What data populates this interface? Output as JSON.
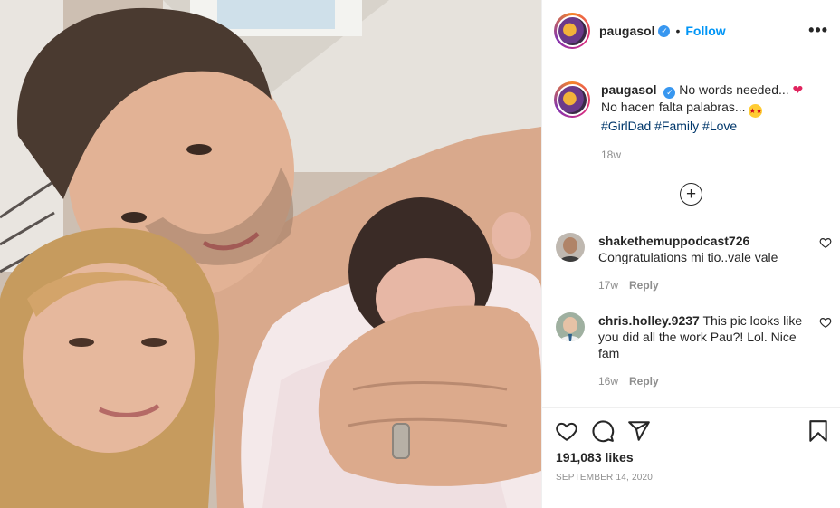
{
  "post": {
    "username": "paugasol",
    "follow_label": "Follow",
    "more_label": "•••",
    "caption_line1": "No words needed... ",
    "caption_line2": "No hacen falta palabras... ",
    "hashtags": [
      "#GirlDad",
      "#Family",
      "#Love"
    ],
    "caption_time": "18w",
    "likes": "191,083 likes",
    "date": "SEPTEMBER 14, 2020"
  },
  "comments": [
    {
      "username": "shakethemuppodcast726",
      "text": "Congratulations mi tio..vale vale",
      "time": "17w",
      "reply_label": "Reply"
    },
    {
      "username": "chris.holley.9237",
      "text": "This pic looks like you did all the work Pau?! Lol. Nice fam",
      "time": "16w",
      "reply_label": "Reply"
    }
  ],
  "icons": {
    "verified": "verified-badge-icon",
    "load_more": "plus-circle-icon",
    "like": "heart-outline-icon",
    "comment": "speech-bubble-icon",
    "share": "paper-plane-icon",
    "save": "bookmark-icon",
    "caption_emoji_1": "red-heart-emoji",
    "caption_emoji_2": "star-struck-emoji"
  },
  "colors": {
    "follow_blue": "#0095f6",
    "hashtag_blue": "#00376b",
    "verified_blue": "#3897f0",
    "meta_gray": "#8e8e8e"
  }
}
